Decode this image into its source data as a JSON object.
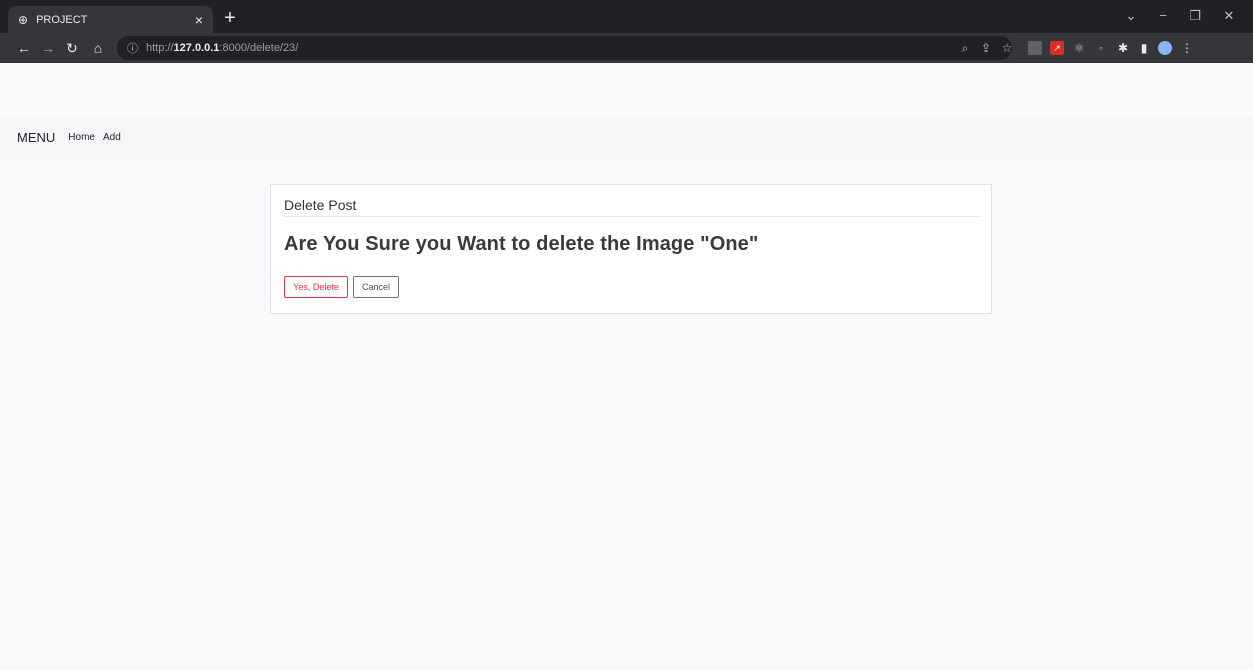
{
  "browser": {
    "tab_title": "PROJECT",
    "url_prefix": "http://",
    "url_host": "127.0.0.1",
    "url_rest": ":8000/delete/23/"
  },
  "navbar": {
    "brand": "MENU",
    "links": [
      "Home",
      "Add"
    ]
  },
  "card": {
    "header": "Delete Post",
    "question": "Are You Sure you Want to delete the Image \"One\"",
    "confirm_label": "Yes, Delete",
    "cancel_label": "Cancel"
  },
  "colors": {
    "danger": "#dc3545",
    "page_bg": "#f8f9fa",
    "chrome_dark": "#202124"
  }
}
